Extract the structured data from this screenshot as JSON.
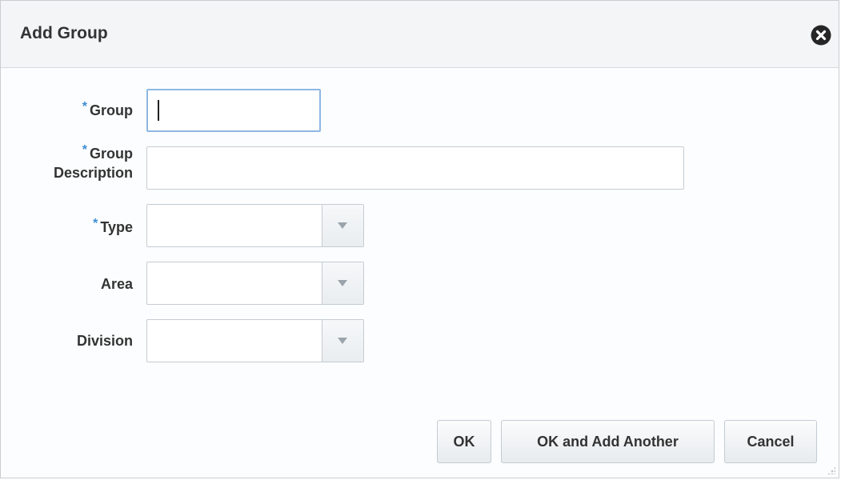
{
  "dialog": {
    "title": "Add Group",
    "close_icon": "close-icon"
  },
  "form": {
    "required_marker": "*",
    "group": {
      "label": "Group",
      "required": true,
      "value": ""
    },
    "group_description": {
      "label_line1": "Group",
      "label_line2": "Description",
      "required": true,
      "value": ""
    },
    "type": {
      "label": "Type",
      "required": true,
      "value": ""
    },
    "area": {
      "label": "Area",
      "required": false,
      "value": ""
    },
    "division": {
      "label": "Division",
      "required": false,
      "value": ""
    }
  },
  "buttons": {
    "ok": "OK",
    "ok_add_another": "OK and Add Another",
    "cancel": "Cancel"
  },
  "colors": {
    "required_marker": "#3d8ed4",
    "focus_border": "#8eb8e4",
    "title_text": "#333333"
  }
}
